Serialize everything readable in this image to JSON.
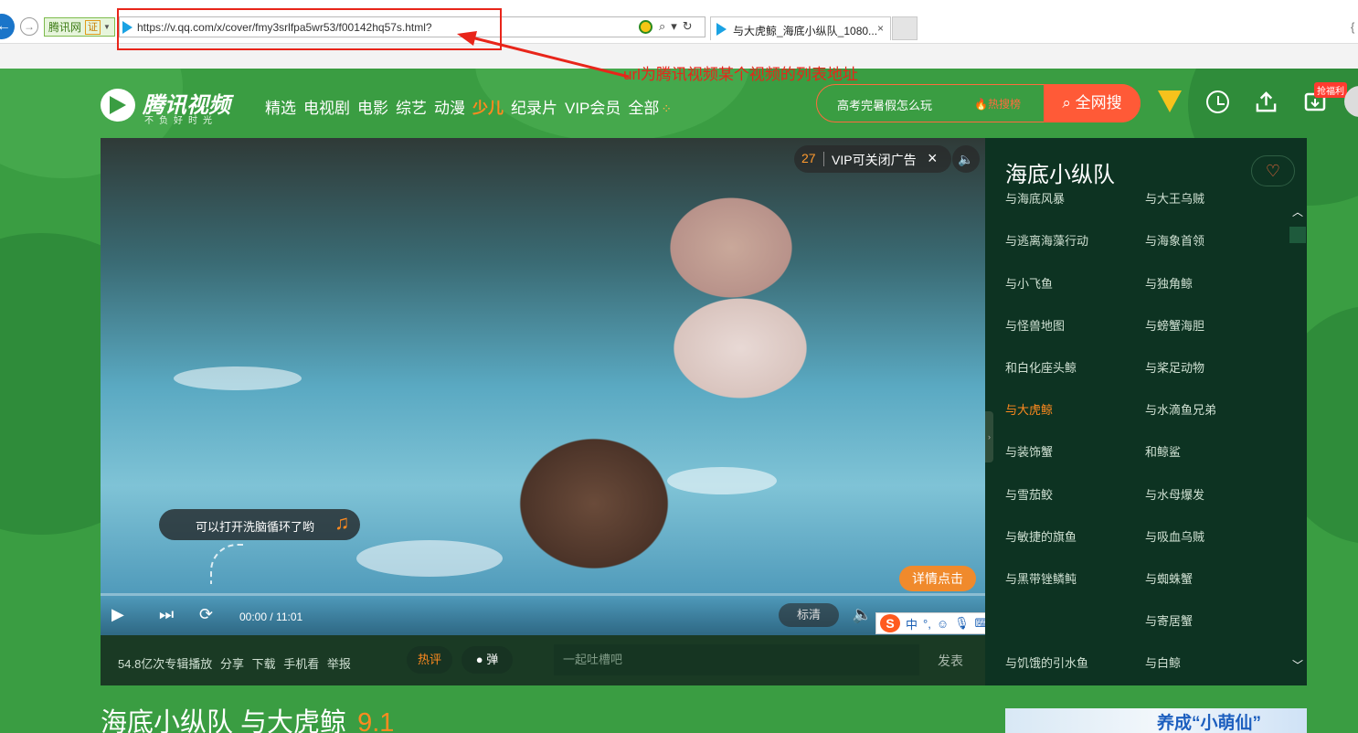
{
  "browser": {
    "site_badge": "腾讯网",
    "cert_label": "证",
    "url": "https://v.qq.com/x/cover/fmy3srlfpa5wr53/f00142hq57s.html?",
    "tab_title": "与大虎鲸_海底小纵队_1080...",
    "tab_close": "×"
  },
  "annotation": {
    "text": "url为腾讯视频某个视频的列表地址",
    "color": "#e8251a"
  },
  "site": {
    "logo_text": "腾讯视频",
    "logo_slogan": "不负好时光",
    "nav": [
      "精选",
      "电视剧",
      "电影",
      "综艺",
      "动漫",
      "少儿",
      "纪录片",
      "VIP会员",
      "全部"
    ],
    "nav_active": "少儿",
    "search_placeholder": "高考完暑假怎么玩",
    "search_hot": "热搜榜",
    "search_button": "全网搜",
    "gift_badge": "抢福利",
    "brand_color": "#3a9d42",
    "accent_color": "#ff8a1f"
  },
  "player": {
    "ad_countdown": "27",
    "ad_text": "VIP可关闭广告",
    "bubble_text": "可以打开洗脑循环了哟",
    "detail_button": "详情点击",
    "time": "00:00 / 11:01",
    "quality": "标清",
    "ime_label": "中"
  },
  "below_player": {
    "stats": "54.8亿次专辑播放",
    "links": [
      "分享",
      "下载",
      "手机看",
      "举报"
    ],
    "hot_tab": "热评",
    "danmu": "弹",
    "danmu_placeholder": "一起吐槽吧",
    "send": "发表"
  },
  "playlist": {
    "title": "海底小纵队",
    "items": [
      "与海底风暴",
      "与大王乌贼",
      "与逃离海藻行动",
      "与海象首领",
      "与小飞鱼",
      "与独角鲸",
      "与怪兽地图",
      "与螃蟹海胆",
      "和白化座头鲸",
      "与桨足动物",
      "与大虎鲸",
      "与水滴鱼兄弟",
      "与装饰蟹",
      "和鲸鲨",
      "与雪茄鲛",
      "与水母爆发",
      "与敏捷的旗鱼",
      "与吸血乌贼",
      "与黑带锉鳞鲀",
      "与蜘蛛蟹",
      "",
      "与寄居蟹",
      "与饥饿的引水鱼",
      "与白鲸"
    ],
    "active_item": "与大虎鲸"
  },
  "video_title": {
    "name": "海底小纵队 与大虎鲸",
    "score": "9.1"
  },
  "banner_text": "养成“小萌仙”"
}
